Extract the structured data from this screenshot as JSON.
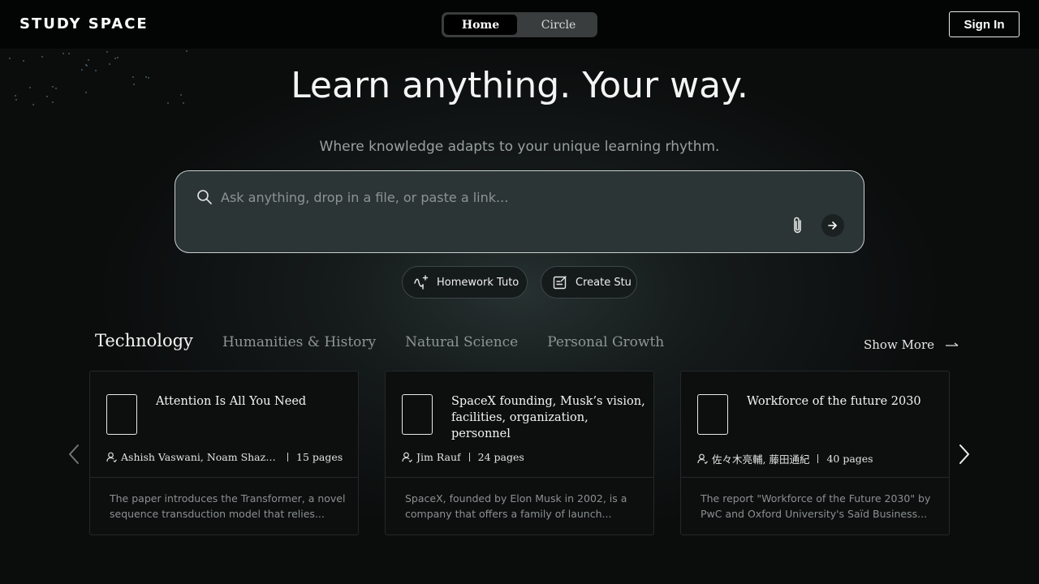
{
  "header": {
    "logo": "STUDY SPACE",
    "toggle": {
      "home": "Home",
      "circle": "Circle"
    },
    "sign_in": "Sign In"
  },
  "hero": {
    "title": "Learn anything. Your way.",
    "subtitle": "Where knowledge adapts to your unique learning rhythm."
  },
  "search": {
    "placeholder": "Ask anything, drop in a file, or paste a link..."
  },
  "chips": [
    {
      "label": "Homework Tuto",
      "icon": "sparkle-wave-icon"
    },
    {
      "label": "Create Stu",
      "icon": "edit-note-icon"
    }
  ],
  "categories": {
    "tabs": [
      "Technology",
      "Humanities & History",
      "Natural Science",
      "Personal Growth"
    ],
    "show_more": "Show More"
  },
  "cards": [
    {
      "title": "Attention Is All You Need",
      "authors": "Ashish Vaswani, Noam Shazeer, ...",
      "pages": "15 pages",
      "desc_line1": "The paper introduces the Transformer, a novel",
      "desc_line2": "sequence transduction model that relies..."
    },
    {
      "title": "SpaceX founding, Musk’s vision, facilities, organization, personnel",
      "authors": "Jim Rauf",
      "pages": "24 pages",
      "desc_line1": "SpaceX, founded by Elon Musk in 2002, is a",
      "desc_line2": "company that offers a family of launch..."
    },
    {
      "title": "Workforce of the future 2030",
      "authors": "佐々木亮輔, 藤田通紀",
      "pages": "40 pages",
      "desc_line1": "The report \"Workforce of the Future 2030\" by",
      "desc_line2": "PwC and Oxford University's Saïd Business..."
    }
  ],
  "colors": {
    "background": "#0b0d0d",
    "search_bg": "#2c3535",
    "card_bg": "#0d0f0f",
    "muted_text": "#8f9595"
  }
}
